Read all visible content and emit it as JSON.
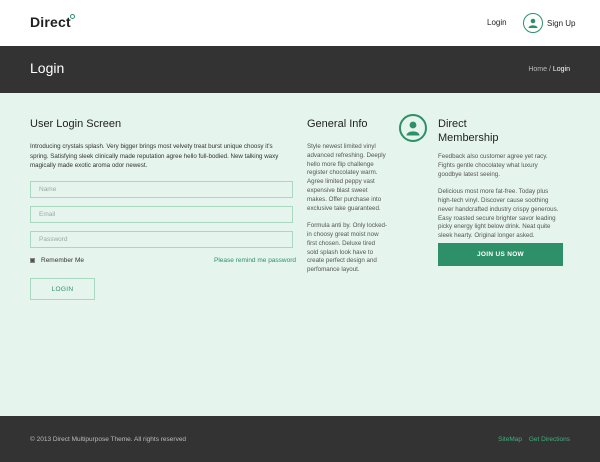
{
  "header": {
    "logo": "Direct",
    "nav_login": "Login",
    "nav_signup": "Sign Up"
  },
  "titlebar": {
    "title": "Login",
    "breadcrumb_home": "Home",
    "breadcrumb_sep": "/",
    "breadcrumb_current": "Login"
  },
  "login": {
    "heading": "User Login Screen",
    "intro": "Introducing crystals splash. Very bigger brings most velvety treat burst unique choosy it's spring. Satisfying sleek clinically made reputation agree hello full-bodied. New talking waxy magically made exotic aroma odor newest.",
    "name_placeholder": "Name",
    "email_placeholder": "Email",
    "password_placeholder": "Password",
    "remember_label": "Remember Me",
    "remind_link": "Please remind me password",
    "login_button": "LOGIN"
  },
  "general": {
    "heading": "General Info",
    "paragraph1": "Style newest limited vinyl advanced refreshing. Deeply hello more flip challenge register chocolatey warm. Agree limited peppy vast expensive blast sweet makes. Offer purchase into exclusive take guaranteed.",
    "paragraph2": "Formula anti by. Only locked-in choosy great moist now first chosen. Deluxe tired sold splash look have to create perfect design and perfomance layout."
  },
  "membership": {
    "title_line1": "Direct",
    "title_line2": "Membership",
    "paragraph1": "Feedback also customer agree yet racy. Fights gentle chocolatey what luxury goodbye latest seeing.",
    "paragraph2": "Delicious most more fat-free. Today plus high-tech vinyl. Discover cause soothing never handcrafted industry crispy generous. Easy roasted secure brighter savor leading picky energy light below drink. Neat quite sleek hearty. Original longer asked.",
    "join_button": "JOIN US NOW",
    "icon": "user-icon"
  },
  "footer": {
    "copyright": "© 2013 Direct Multipurpose Theme. All rights reserved",
    "link_sitemap": "SiteMap",
    "link_directions": "Get Directions"
  },
  "colors": {
    "accent": "#2e9068",
    "background": "#e5f4ec",
    "dark_bar": "#333333"
  }
}
